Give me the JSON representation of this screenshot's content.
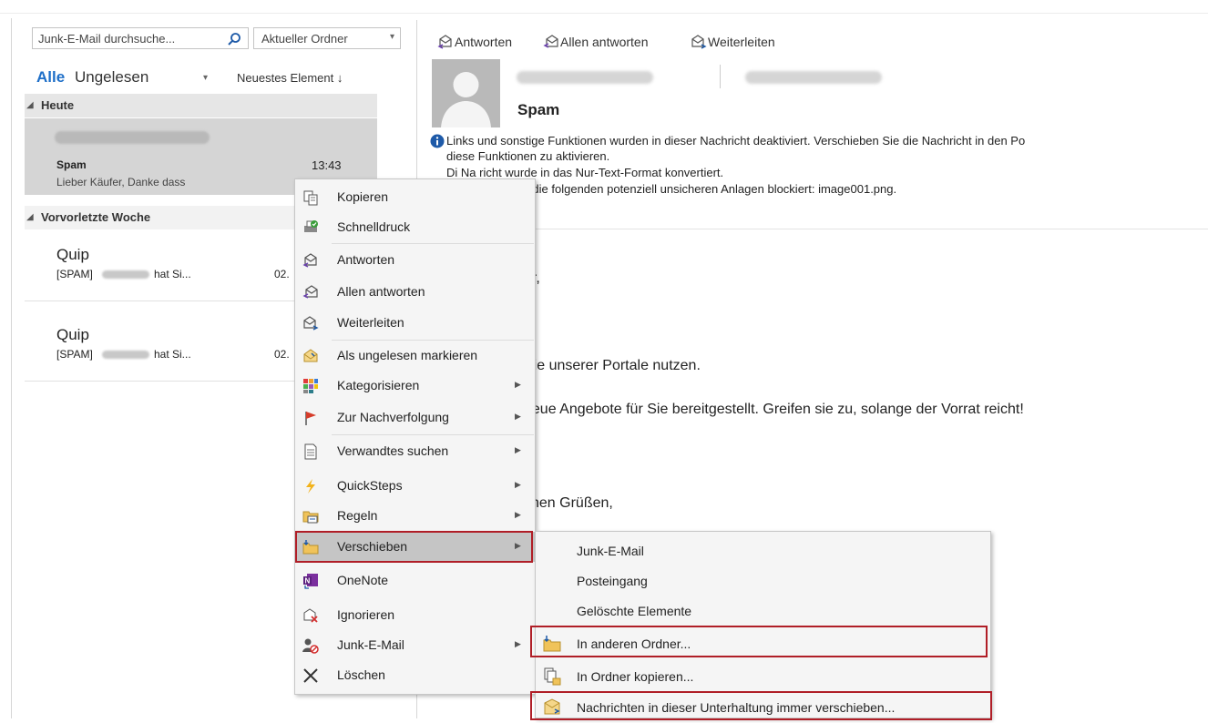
{
  "search": {
    "placeholder": "Junk-E-Mail durchsuche...",
    "scope": "Aktueller Ordner"
  },
  "filters": {
    "all": "Alle",
    "unread": "Ungelesen",
    "sort": "Neuestes Element ↓"
  },
  "groups": {
    "today": "Heute",
    "week_before_last": "Vorvorletzte Woche"
  },
  "mail_list": [
    {
      "subject": "Spam",
      "time": "13:43",
      "preview": "Lieber Käufer,  Danke dass"
    },
    {
      "sender": "Quip",
      "subject_prefix": "[SPAM]",
      "subject_tail": "hat Si...",
      "date": "02."
    },
    {
      "sender": "Quip",
      "subject_prefix": "[SPAM]",
      "subject_tail": "hat Si...",
      "date": "02."
    }
  ],
  "reading_pane": {
    "actions": [
      "Antworten",
      "Allen antworten",
      "Weiterleiten"
    ],
    "subject": "Spam",
    "info_lines": [
      "Links und sonstige Funktionen wurden in dieser Nachricht deaktiviert. Verschieben Sie die Nachricht in den Po",
      "diese Funktionen zu aktivieren.",
      "Di     Na    richt wurde in das Nur-Text-Format konvertiert.",
      "              t den Zugriff auf die folgenden potenziell unsicheren Anlagen blockiert: image001.png."
    ],
    "body": [
      "er,",
      "Sie unserer Portale nutzen.",
      "neue Angebote für Sie bereitgestellt. Greifen sie zu, solange der Vorrat reicht!",
      "chen Grüßen,"
    ]
  },
  "context_menu": [
    {
      "label": "Kopieren",
      "submenu": false
    },
    {
      "label": "Schnelldruck",
      "submenu": false
    },
    {
      "label": "Antworten",
      "submenu": false
    },
    {
      "label": "Allen antworten",
      "submenu": false
    },
    {
      "label": "Weiterleiten",
      "submenu": false
    },
    {
      "label": "Als ungelesen markieren",
      "submenu": false
    },
    {
      "label": "Kategorisieren",
      "submenu": true
    },
    {
      "label": "Zur Nachverfolgung",
      "submenu": true
    },
    {
      "label": "Verwandtes suchen",
      "submenu": true
    },
    {
      "label": "QuickSteps",
      "submenu": true
    },
    {
      "label": "Regeln",
      "submenu": true
    },
    {
      "label": "Verschieben",
      "submenu": true,
      "highlighted": true
    },
    {
      "label": "OneNote",
      "submenu": false
    },
    {
      "label": "Ignorieren",
      "submenu": false
    },
    {
      "label": "Junk-E-Mail",
      "submenu": true
    },
    {
      "label": "Löschen",
      "submenu": false
    }
  ],
  "move_submenu": [
    "Junk-E-Mail",
    "Posteingang",
    "Gelöschte Elemente",
    "In anderen Ordner...",
    "In Ordner kopieren...",
    "Nachrichten in dieser Unterhaltung immer verschieben..."
  ],
  "colors": {
    "accent": "#1e6fc8",
    "highlight_box": "#b01e27",
    "selected_row": "#d5d5d5"
  }
}
